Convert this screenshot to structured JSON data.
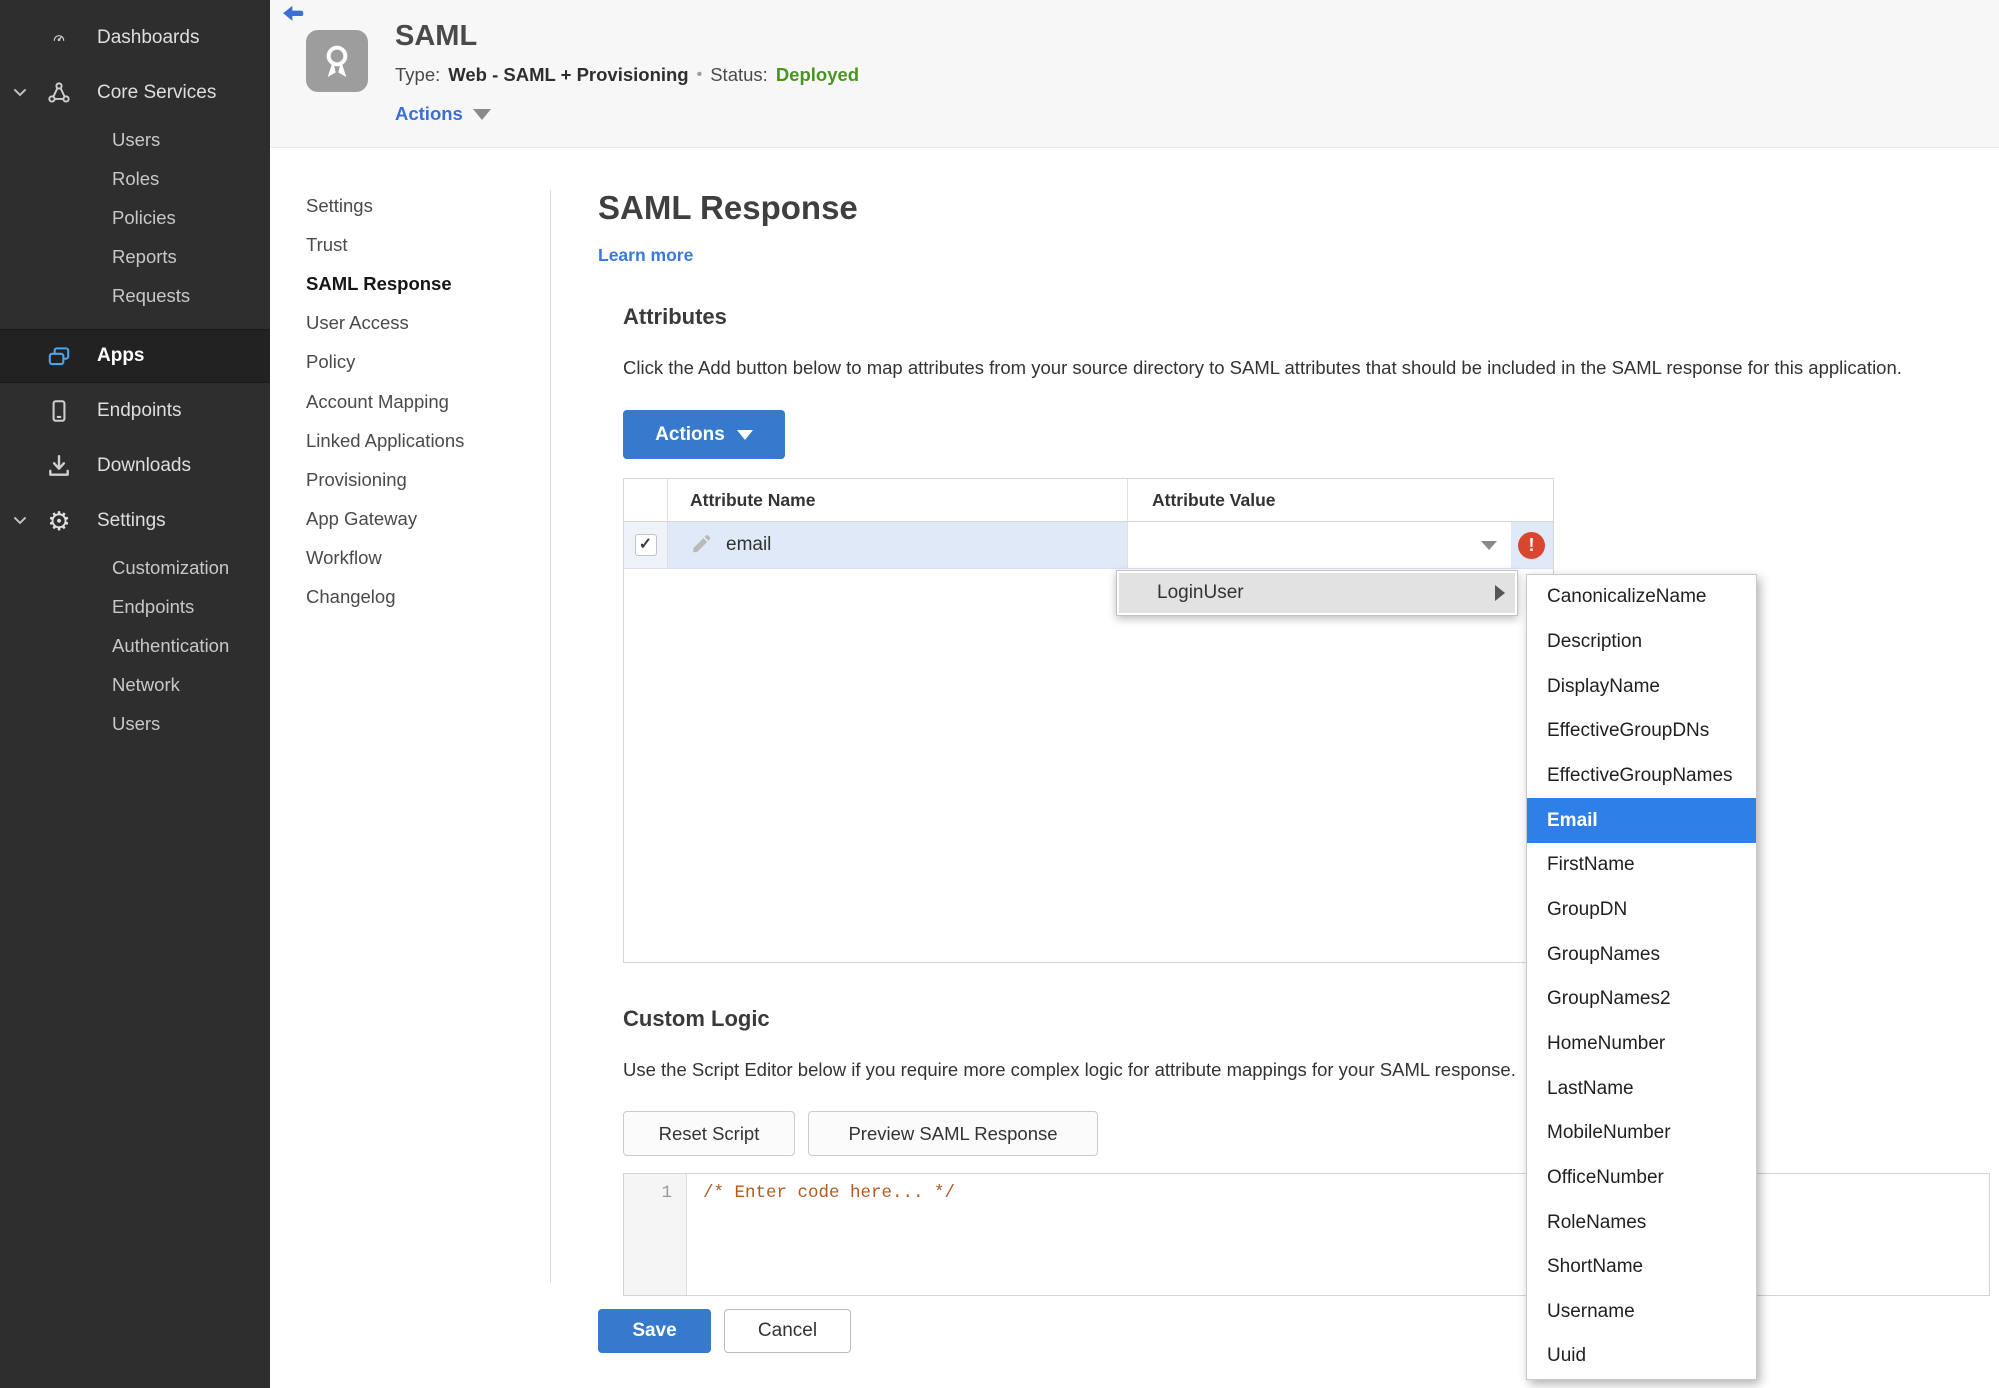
{
  "colors": {
    "sidebar_bg": "#2e2e2e",
    "accent_blue": "#3a78d6",
    "button_blue": "#3779cd",
    "selection_blue": "#2e80e8",
    "sidebar_icon_blue": "#4aa6ec",
    "status_green": "#4a9522",
    "error_red": "#d9452f",
    "code_orange": "#b35a1f",
    "row_highlight": "#dfe9f7",
    "header_band": "#f7f7f7"
  },
  "sidebar": {
    "items": [
      {
        "label": "Dashboards",
        "icon": "dashboard"
      },
      {
        "label": "Core Services",
        "icon": "core-services",
        "expanded": true
      },
      {
        "label": "Users"
      },
      {
        "label": "Roles"
      },
      {
        "label": "Policies"
      },
      {
        "label": "Reports"
      },
      {
        "label": "Requests"
      },
      {
        "label": "Apps",
        "icon": "apps",
        "active": true
      },
      {
        "label": "Endpoints",
        "icon": "endpoint"
      },
      {
        "label": "Downloads",
        "icon": "download"
      },
      {
        "label": "Settings",
        "icon": "gear",
        "expanded": true
      },
      {
        "label": "Customization"
      },
      {
        "label": "Endpoints"
      },
      {
        "label": "Authentication"
      },
      {
        "label": "Network"
      },
      {
        "label": "Users"
      }
    ]
  },
  "header": {
    "title": "SAML",
    "type_label": "Type:",
    "type_value": "Web - SAML + Provisioning",
    "separator": "•",
    "status_label": "Status:",
    "status_value": "Deployed",
    "actions_label": "Actions"
  },
  "subnav": {
    "active": "SAML Response",
    "items": [
      "Settings",
      "Trust",
      "SAML Response",
      "User Access",
      "Policy",
      "Account Mapping",
      "Linked Applications",
      "Provisioning",
      "App Gateway",
      "Workflow",
      "Changelog"
    ]
  },
  "main": {
    "title": "SAML Response",
    "learn_more": "Learn more"
  },
  "attributes": {
    "heading": "Attributes",
    "description": "Click the Add button below to map attributes from your source directory to SAML attributes that should be included in the SAML response for this application.",
    "actions_button": "Actions",
    "table": {
      "columns": [
        "Attribute Name",
        "Attribute Value"
      ],
      "rows": [
        {
          "checked": true,
          "name": "email",
          "value": "",
          "error": true
        }
      ]
    }
  },
  "value_menu": {
    "items": [
      {
        "label": "LoginUser",
        "has_submenu": true
      }
    ]
  },
  "attribute_submenu": {
    "selected": "Email",
    "options": [
      "CanonicalizeName",
      "Description",
      "DisplayName",
      "EffectiveGroupDNs",
      "EffectiveGroupNames",
      "Email",
      "FirstName",
      "GroupDN",
      "GroupNames",
      "GroupNames2",
      "HomeNumber",
      "LastName",
      "MobileNumber",
      "OfficeNumber",
      "RoleNames",
      "ShortName",
      "Username",
      "Uuid"
    ]
  },
  "custom_logic": {
    "heading": "Custom Logic",
    "description": "Use the Script Editor below if you require more complex logic for attribute mappings for your SAML response.",
    "reset_button": "Reset Script",
    "preview_button": "Preview SAML Response",
    "editor": {
      "line_number": "1",
      "code": "/* Enter code here... */"
    }
  },
  "footer": {
    "save": "Save",
    "cancel": "Cancel"
  }
}
